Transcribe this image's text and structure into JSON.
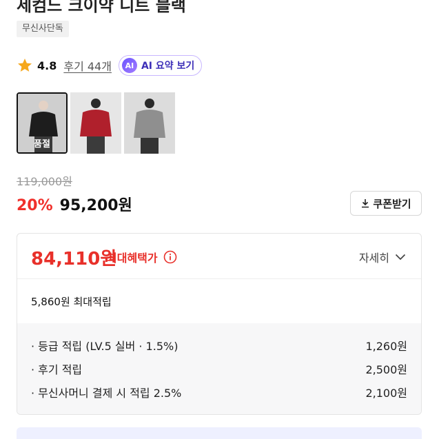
{
  "product": {
    "title": "세컴느 크이약 니트 블랙",
    "exclusive_badge": "무신사단독"
  },
  "rating": {
    "score": "4.8",
    "reviews_label": "후기 44개",
    "ai_badge": "AI",
    "ai_summary_label": "AI 요약 보기"
  },
  "thumbnails": [
    {
      "soldout_label": "품절",
      "color": "#2a2a2a"
    },
    {
      "soldout_label": "",
      "color": "#b0202c"
    },
    {
      "soldout_label": "",
      "color": "#8f8f8f"
    }
  ],
  "pricing": {
    "original_price": "119,000원",
    "discount": "20%",
    "sale_price": "95,200원",
    "coupon_label": "쿠폰받기"
  },
  "benefits": {
    "best_price": "84,110원",
    "best_label": "최대혜택가",
    "detail_label": "자세히",
    "points_total": "5,860원 최대적립",
    "rows": [
      {
        "label": "· 등급 적립 (LV.5 실버 · 1.5%)",
        "value": "1,260원"
      },
      {
        "label": "· 후기 적립",
        "value": "2,500원"
      },
      {
        "label": "· 무신사머니 결제 시 적립 2.5%",
        "value": "2,100원"
      }
    ]
  },
  "colors": {
    "accent_red": "#e8302a",
    "ai_purple": "#3d2fb8"
  }
}
